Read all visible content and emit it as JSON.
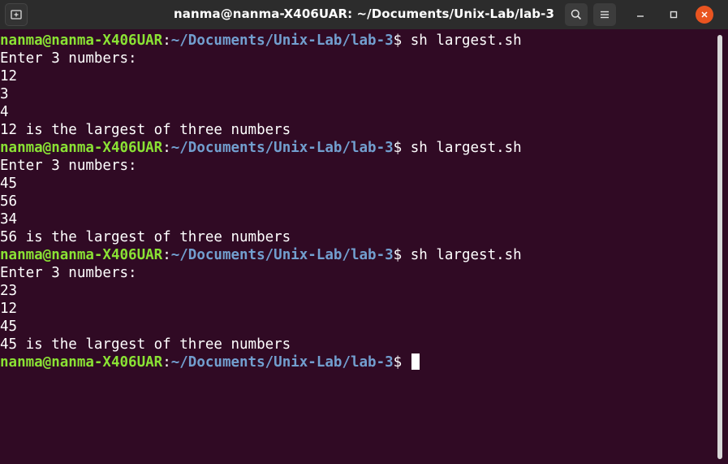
{
  "window": {
    "title": "nanma@nanma-X406UAR: ~/Documents/Unix-Lab/lab-3"
  },
  "titlebar": {
    "icons": {
      "new_tab": "new-tab-icon",
      "search": "search-icon",
      "menu": "hamburger-menu-icon",
      "minimize": "minimize-icon",
      "maximize": "maximize-icon",
      "close": "close-icon"
    },
    "close_color": "#e95420"
  },
  "colors": {
    "background": "#300a24",
    "user_host": "#8ae234",
    "path": "#729fcf",
    "text": "#ffffff"
  },
  "prompt": {
    "user_host": "nanma@nanma-X406UAR",
    "colon": ":",
    "path": "~/Documents/Unix-Lab/lab-3",
    "dollar": "$ "
  },
  "lines": [
    {
      "type": "prompt",
      "command": "sh largest.sh"
    },
    {
      "type": "output",
      "text": "Enter 3 numbers:"
    },
    {
      "type": "output",
      "text": "12"
    },
    {
      "type": "output",
      "text": "3"
    },
    {
      "type": "output",
      "text": "4"
    },
    {
      "type": "output",
      "text": "12 is the largest of three numbers"
    },
    {
      "type": "prompt",
      "command": "sh largest.sh"
    },
    {
      "type": "output",
      "text": "Enter 3 numbers:"
    },
    {
      "type": "output",
      "text": "45"
    },
    {
      "type": "output",
      "text": "56"
    },
    {
      "type": "output",
      "text": "34"
    },
    {
      "type": "output",
      "text": "56 is the largest of three numbers"
    },
    {
      "type": "prompt",
      "command": "sh largest.sh"
    },
    {
      "type": "output",
      "text": "Enter 3 numbers:"
    },
    {
      "type": "output",
      "text": "23"
    },
    {
      "type": "output",
      "text": "12"
    },
    {
      "type": "output",
      "text": "45"
    },
    {
      "type": "output",
      "text": "45 is the largest of three numbers"
    },
    {
      "type": "prompt",
      "command": "",
      "cursor": true
    }
  ]
}
